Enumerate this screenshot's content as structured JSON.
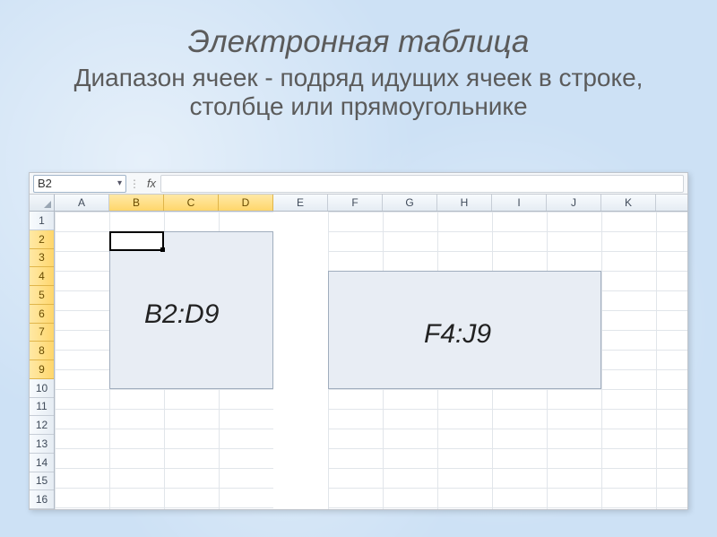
{
  "heading": {
    "title": "Электронная таблица",
    "subtitle": "Диапазон ячеек - подряд идущих ячеек в строке, столбце или прямоугольнике"
  },
  "formula_bar": {
    "name_box_value": "B2",
    "fx_label": "fx",
    "formula_value": ""
  },
  "columns": [
    "A",
    "B",
    "C",
    "D",
    "E",
    "F",
    "G",
    "H",
    "I",
    "J",
    "K"
  ],
  "rows": [
    "1",
    "2",
    "3",
    "4",
    "5",
    "6",
    "7",
    "8",
    "9",
    "10",
    "11",
    "12",
    "13",
    "14",
    "15",
    "16"
  ],
  "selected_columns": [
    "B",
    "C",
    "D"
  ],
  "selected_rows": [
    "2",
    "3",
    "4",
    "5",
    "6",
    "7",
    "8",
    "9"
  ],
  "active_cell": "B2",
  "ranges": {
    "left_label": "B2:D9",
    "right_label": "F4:J9"
  }
}
